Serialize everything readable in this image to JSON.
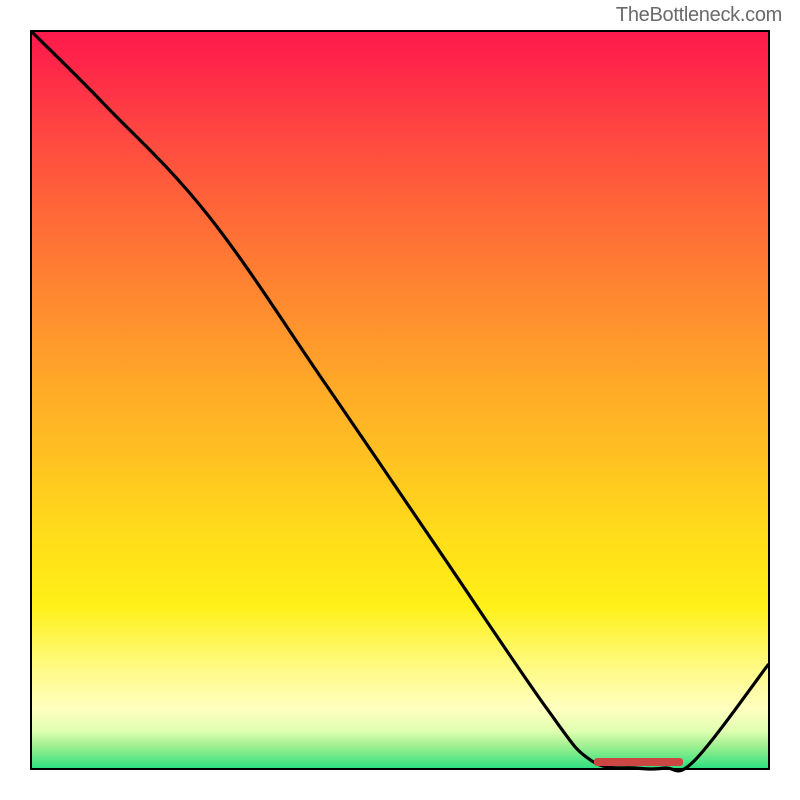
{
  "watermark": "TheBottleneck.com",
  "chart_data": {
    "type": "line",
    "title": "",
    "xlabel": "",
    "ylabel": "",
    "xlim": [
      0,
      100
    ],
    "ylim": [
      0,
      100
    ],
    "series": [
      {
        "name": "curve",
        "x": [
          0,
          10,
          24,
          40,
          55,
          70,
          76,
          82,
          86,
          90,
          100
        ],
        "values": [
          100,
          90,
          75,
          52,
          30,
          8,
          1,
          0,
          0,
          1,
          14
        ]
      }
    ],
    "marker": {
      "x_start": 76,
      "x_end": 88,
      "y": 0
    },
    "gradient_colors": {
      "top": "#ff1a4d",
      "mid_upper": "#ff8830",
      "mid": "#ffe018",
      "mid_lower": "#fffa80",
      "bottom": "#30e080"
    }
  }
}
